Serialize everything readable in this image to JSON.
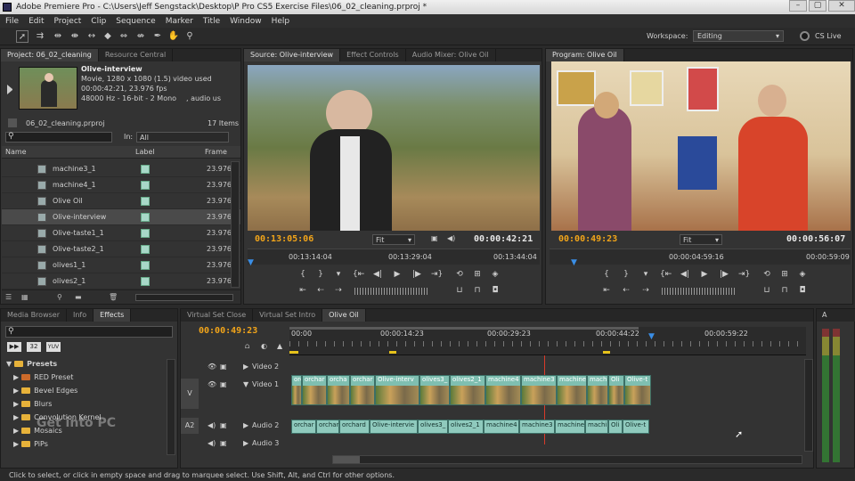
{
  "window": {
    "title": "Adobe Premiere Pro - C:\\Users\\Jeff Sengstack\\Desktop\\P Pro CS5 Exercise Files\\06_02_cleaning.prproj *"
  },
  "menu": [
    "File",
    "Edit",
    "Project",
    "Clip",
    "Sequence",
    "Marker",
    "Title",
    "Window",
    "Help"
  ],
  "workspace": {
    "label": "Workspace:",
    "value": "Editing",
    "cslive": "CS Live"
  },
  "project_panel": {
    "tabs": [
      "Project: 06_02_cleaning",
      "Resource Central"
    ],
    "clip_name": "Olive-interview",
    "clip_info": [
      "Movie, 1280 x 1080 (1.5)",
      "00:00:42:21, 23.976 fps",
      "48000 Hz - 16-bit - 2 Mono"
    ],
    "clip_info_extra": [
      ", video used",
      "",
      ", audio us"
    ],
    "project_file": "06_02_cleaning.prproj",
    "item_count": "17 Items",
    "in_label": "In:",
    "in_value": "All",
    "columns": [
      "Name",
      "Label",
      "Frame"
    ],
    "items": [
      {
        "name": "machine3_1",
        "frame": "23.976"
      },
      {
        "name": "machine4_1",
        "frame": "23.976"
      },
      {
        "name": "Olive Oil",
        "frame": "23.976"
      },
      {
        "name": "Olive-interview",
        "frame": "23.976"
      },
      {
        "name": "Olive-taste1_1",
        "frame": "23.976"
      },
      {
        "name": "Olive-taste2_1",
        "frame": "23.976"
      },
      {
        "name": "olives1_1",
        "frame": "23.976"
      },
      {
        "name": "olives2_1",
        "frame": "23.976"
      }
    ],
    "selected_index": 3
  },
  "source_panel": {
    "tabs": [
      "Source: Olive-interview",
      "Effect Controls",
      "Audio Mixer: Olive Oil"
    ],
    "timecode": "00:13:05:06",
    "fit": "Fit",
    "duration": "00:00:42:21",
    "ruler": [
      "00:13:14:04",
      "00:13:29:04",
      "00:13:44:04"
    ]
  },
  "program_panel": {
    "tabs": [
      "Program: Olive Oil"
    ],
    "timecode": "00:00:49:23",
    "fit": "Fit",
    "duration": "00:00:56:07",
    "ruler": [
      "00:00:04:59:16",
      "00:00:59:09"
    ]
  },
  "effects_panel": {
    "tabs": [
      "Media Browser",
      "Info",
      "Effects"
    ],
    "badges": [
      "32",
      "YUV"
    ],
    "items": [
      {
        "label": "Presets",
        "folder": true
      },
      {
        "label": "RED Preset",
        "folder": false
      },
      {
        "label": "Bevel Edges",
        "folder": true
      },
      {
        "label": "Blurs",
        "folder": true
      },
      {
        "label": "Convolution Kernel",
        "folder": true
      },
      {
        "label": "Mosaics",
        "folder": true
      },
      {
        "label": "PiPs",
        "folder": true
      }
    ]
  },
  "timeline": {
    "tabs": [
      "Virtual Set Close",
      "Virtual Set Intro",
      "Olive Oil"
    ],
    "timecode": "00:00:49:23",
    "ruler": [
      "00:00",
      "00:00:14:23",
      "00:00:29:23",
      "00:00:44:22",
      "00:00:59:22"
    ],
    "tracks": [
      "Video 2",
      "Video 1",
      "Audio 2",
      "Audio 3"
    ],
    "side_labels": [
      "V",
      "A2"
    ],
    "video_clips": [
      "orcl",
      "orchar",
      "orcha",
      "orchar",
      "Olive-interv",
      "olives3_",
      "olives2_1",
      "machine4",
      "machine3",
      "machine1",
      "mach",
      "Oli",
      "Olive-t"
    ],
    "audio_clips": [
      "orchar",
      "orchar",
      "orchard",
      "Olive-intervie",
      "olives3_",
      "olives2_1",
      "machine4",
      "machine3",
      "machine1",
      "machi",
      "Oli",
      "Olive-t"
    ]
  },
  "status": "Click to select, or click in empty space and drag to marquee select. Use Shift, Alt, and Ctrl for other options.",
  "watermark": "Get into PC"
}
